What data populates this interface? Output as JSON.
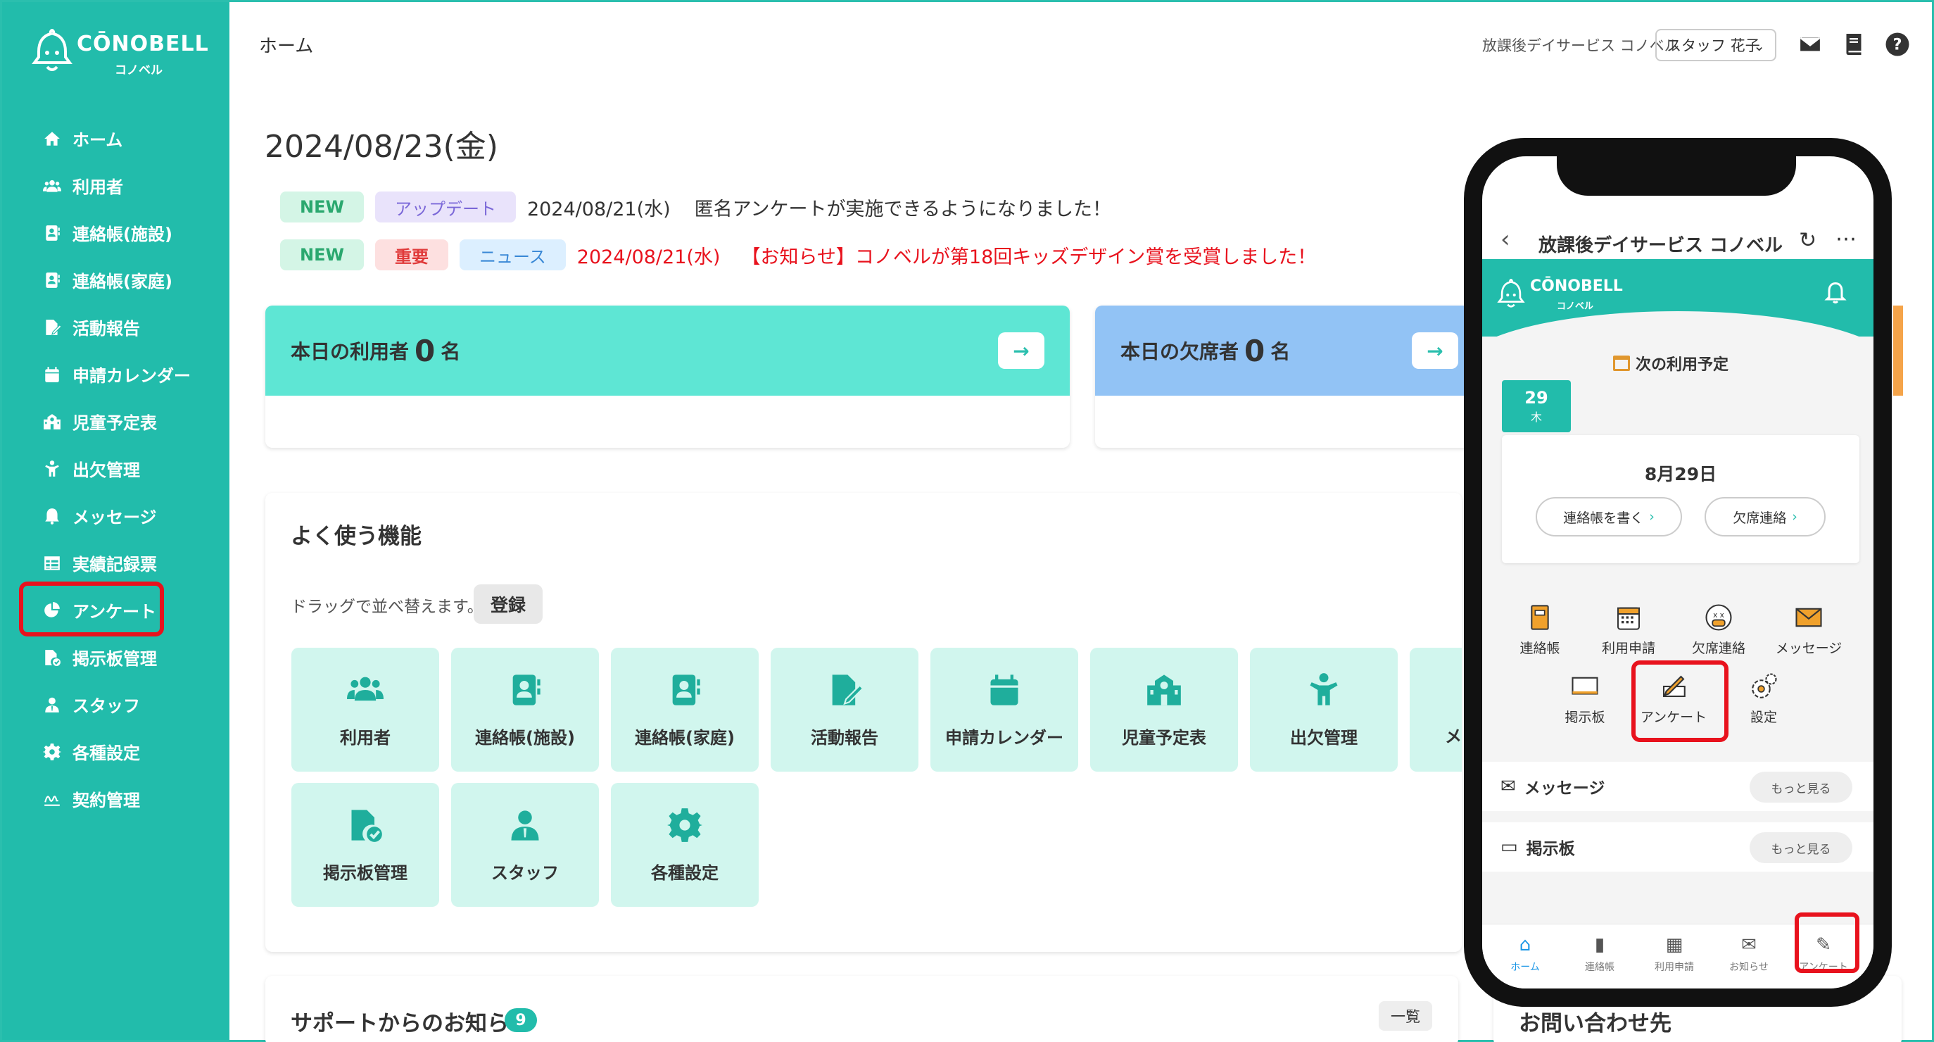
{
  "brand": {
    "logo_text": "CŌNOBELL",
    "logo_sub": "コノベル"
  },
  "sidebar": {
    "items": [
      {
        "label": "ホーム",
        "icon": "home-icon"
      },
      {
        "label": "利用者",
        "icon": "users-icon"
      },
      {
        "label": "連絡帳(施設)",
        "icon": "contact-book-icon"
      },
      {
        "label": "連絡帳(家庭)",
        "icon": "contact-book-icon"
      },
      {
        "label": "活動報告",
        "icon": "report-icon"
      },
      {
        "label": "申請カレンダー",
        "icon": "calendar-icon"
      },
      {
        "label": "児童予定表",
        "icon": "school-icon"
      },
      {
        "label": "出欠管理",
        "icon": "child-icon"
      },
      {
        "label": "メッセージ",
        "icon": "bell-icon"
      },
      {
        "label": "実績記録票",
        "icon": "table-icon"
      },
      {
        "label": "アンケート",
        "icon": "pie-chart-icon"
      },
      {
        "label": "掲示板管理",
        "icon": "board-icon"
      },
      {
        "label": "スタッフ",
        "icon": "staff-icon"
      },
      {
        "label": "各種設定",
        "icon": "gear-icon"
      },
      {
        "label": "契約管理",
        "icon": "contract-icon"
      }
    ]
  },
  "header": {
    "title": "ホーム",
    "facility": "放課後デイサービス コノベル",
    "staff": "スタッフ 花子"
  },
  "main": {
    "date": "2024/08/23(金)",
    "news": [
      {
        "badges": [
          "NEW",
          "アップデート"
        ],
        "date": "2024/08/21(水)",
        "text": "匿名アンケートが実施できるようになりました！"
      },
      {
        "badges": [
          "NEW",
          "重要",
          "ニュース"
        ],
        "date": "2024/08/21(水)",
        "text": "【お知らせ】コノベルが第18回キッズデザイン賞を受賞しました！"
      }
    ],
    "today_users": {
      "prefix": "本日の利用者",
      "count": "0",
      "suffix": "名"
    },
    "today_absent": {
      "prefix": "本日の欠席者",
      "count": "0",
      "suffix": "名"
    },
    "functions": {
      "title": "よく使う機能",
      "hint": "ドラッグで並べ替えます。",
      "register": "登録",
      "tiles": [
        "利用者",
        "連絡帳(施設)",
        "連絡帳(家庭)",
        "活動報告",
        "申請カレンダー",
        "児童予定表",
        "出欠管理",
        "メ",
        "掲示板管理",
        "スタッフ",
        "各種設定"
      ]
    },
    "support": {
      "title": "サポートからのお知らせ",
      "count": "9",
      "list_label": "一覧"
    },
    "contact": {
      "title": "お問い合わせ先"
    }
  },
  "phone": {
    "title": "放課後デイサービス コノベル",
    "next_schedule": "次の利用予定",
    "day": "29",
    "weekday": "木",
    "date_label": "8月29日",
    "write_label": "連絡帳を書く",
    "absent_label": "欠席連絡",
    "features": [
      "連絡帳",
      "利用申請",
      "欠席連絡",
      "メッセージ",
      "掲示板",
      "アンケート",
      "設定"
    ],
    "message_section": "メッセージ",
    "board_section": "掲示板",
    "more_label": "もっと見る",
    "tabs": [
      "ホーム",
      "連絡帳",
      "利用申請",
      "お知らせ",
      "アンケート"
    ]
  },
  "colors": {
    "primary": "#22bcab",
    "highlight": "#e8121d",
    "users_card": "#5ee6d4",
    "absent_card": "#92c3f5"
  }
}
